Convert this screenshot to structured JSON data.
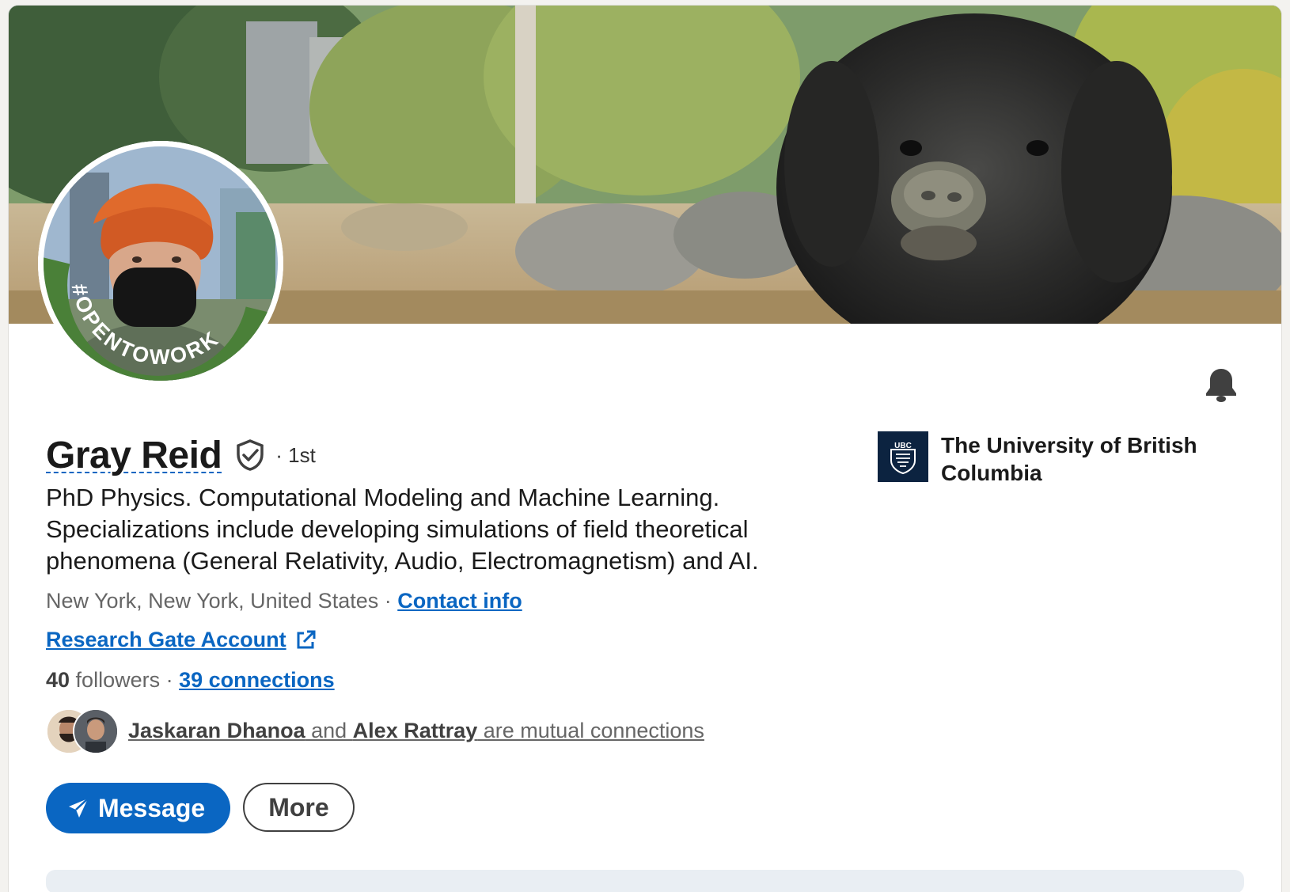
{
  "profile": {
    "name": "Gray Reid",
    "degree": "· 1st",
    "headline": "PhD Physics. Computational Modeling and Machine Learning. Specializations include developing simulations of field theoretical phenomena (General Relativity, Audio, Electromagnetism) and AI.",
    "location": "New York, New York, United States",
    "location_separator": " · ",
    "contact_info_label": "Contact info",
    "website_label": "Research Gate Account",
    "followers_count": "40",
    "followers_label": " followers",
    "connections_separator": "  · ",
    "connections_label": "39 connections",
    "open_to_work_badge": "#OPENTOWORK"
  },
  "mutual": {
    "person1": "Jaskaran Dhanoa",
    "joiner": " and ",
    "person2": "Alex Rattray",
    "suffix": " are mutual connections"
  },
  "actions": {
    "message_label": "Message",
    "more_label": "More"
  },
  "education": {
    "name": "The University of British Columbia",
    "logo_text": "UBC"
  },
  "colors": {
    "accent": "#0a66c2",
    "open_to_work_green": "#4a8038",
    "ubc_navy": "#0c2340",
    "page_background": "#f3f2ef"
  },
  "icons": {
    "notification": "bell-icon",
    "verification": "shield-check-icon",
    "external_link": "external-link-icon",
    "send": "paper-plane-icon"
  }
}
